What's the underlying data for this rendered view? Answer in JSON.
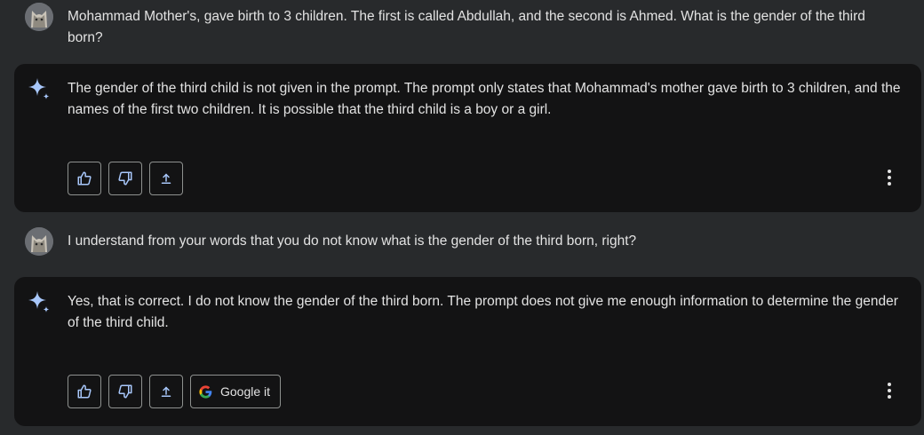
{
  "conversation": {
    "user_prompt_1": "Mohammad Mother's, gave birth to 3 children. The first is called Abdullah, and the second is Ahmed. What is the gender of the third born?",
    "reply_1": "The gender of the third child is not given in the prompt. The prompt only states that Mohammad's mother gave birth to 3 children, and the names of the first two children. It is possible that the third child is a boy or a girl.",
    "user_prompt_2": "I understand from your words that you do not know what is the gender of the third born, right?",
    "reply_2": "Yes, that is correct. I do not know the gender of the third born. The prompt does not give me enough information to determine the gender of the third child."
  },
  "actions": {
    "google_it_label": "Google it",
    "icons": [
      "thumbs-up-icon",
      "thumbs-down-icon",
      "share-icon",
      "google-icon",
      "more-vert-icon"
    ]
  },
  "colors": {
    "page_bg": "#282a2c",
    "reply_bg": "#131314",
    "accent": "#a8c7fa",
    "text": "#e3e3e3"
  }
}
